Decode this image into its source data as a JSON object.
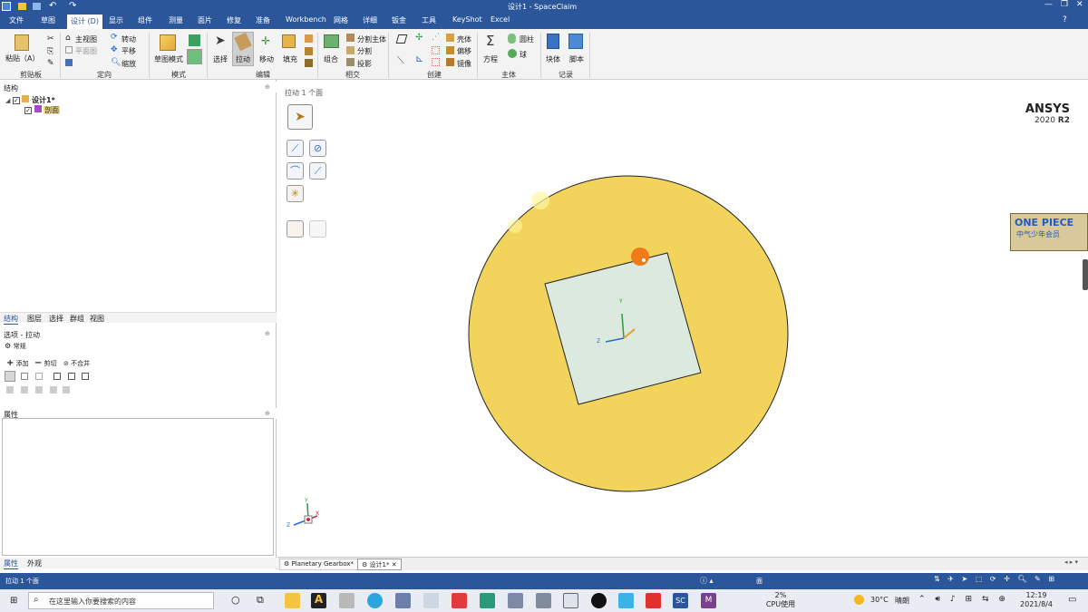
{
  "app_title": "设计1 - SpaceClaim",
  "tabs": [
    "文件",
    "草图",
    "设计 (D)",
    "显示",
    "组件",
    "测量",
    "面片",
    "修复",
    "准备",
    "Workbench",
    "网格",
    "详细",
    "钣金",
    "工具",
    "KeyShot",
    "Excel"
  ],
  "active_tab": "设计 (D)",
  "ribbon": {
    "clipboard": {
      "paste_label": "粘贴（A）",
      "group_label": "剪贴板"
    },
    "orient": {
      "home_view": "主视图",
      "plane_view": "平面图",
      "spin": "转动",
      "pan": "平移",
      "zoom": "缩放",
      "group_label": "定向"
    },
    "mode": {
      "sketch_mode": "草图模式",
      "group_label": "模式"
    },
    "edit": {
      "select": "选择",
      "pull": "拉动",
      "move": "移动",
      "fill": "填充",
      "group_label": "编辑"
    },
    "intersect": {
      "combine": "组合",
      "split_body": "分割主体",
      "split": "分割",
      "project": "投影",
      "group_label": "相交"
    },
    "create": {
      "shell": "壳体",
      "offset": "偏移",
      "mirror": "镜像",
      "group_label": "创建"
    },
    "body": {
      "equation": "方程",
      "cylinder": "圆柱",
      "sphere": "球",
      "group_label": "主体"
    },
    "record": {
      "block": "块体",
      "script": "脚本",
      "group_label": "记录"
    }
  },
  "structure_panel": {
    "header": "结构",
    "tree": [
      {
        "label": "设计1*",
        "checked": true
      },
      {
        "label": "剖面",
        "checked": true
      }
    ],
    "bottom_tabs": [
      "结构",
      "图层",
      "选择",
      "群组",
      "视图"
    ]
  },
  "options_panel": {
    "header": "选项 - 拉动",
    "section": "常规",
    "add": "添加",
    "cut": "剪切",
    "no_merge": "不合并"
  },
  "properties_panel": {
    "header": "属性",
    "bottom_tabs": [
      "属性",
      "外观"
    ]
  },
  "viewport": {
    "hint": "拉动 1 个面",
    "brand": "ANSYS",
    "version_prefix": "2020",
    "version_suffix": "R2",
    "axis_y": "Y",
    "axis_z": "Z",
    "axis_x": "X",
    "watermark_line1": "ONE PIECE",
    "watermark_line2": "中气少年会员",
    "colors": {
      "disk": "#f2d45c",
      "square": "#dce9df",
      "handle": "#f07a1a"
    }
  },
  "doc_tabs": [
    "Planetary Gearbox*",
    "设计1*"
  ],
  "status": {
    "left": "拉动 1 个面",
    "center": "面"
  },
  "taskbar": {
    "search_placeholder": "在这里输入你要搜索的内容",
    "cpu_percent": "2%",
    "cpu_label": "CPU使用",
    "weather_temp": "30°C",
    "weather_desc": "晴朗",
    "time": "12:19",
    "date": "2021/8/4"
  }
}
